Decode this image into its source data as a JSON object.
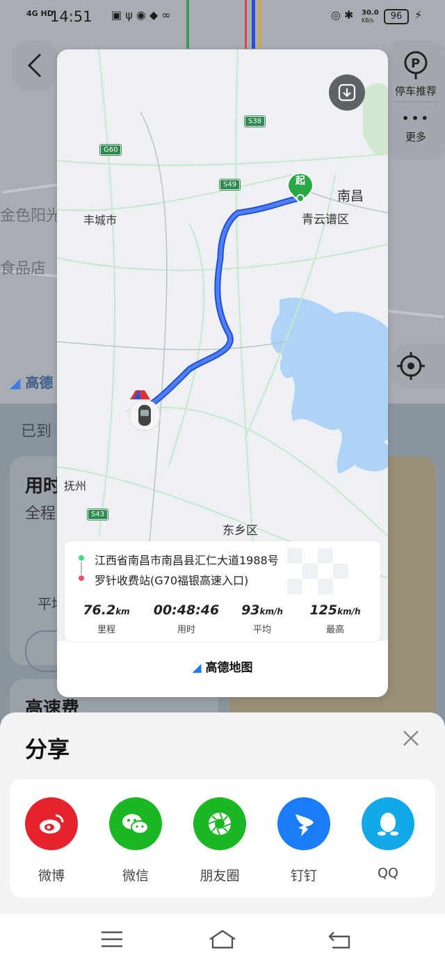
{
  "status_bar": {
    "network": "4G HD",
    "time": "14:51",
    "speed_value": "30.0",
    "speed_unit": "KB/s",
    "battery": "96"
  },
  "background": {
    "parking_label": "停车推荐",
    "more_label": "更多",
    "poi_1": "金色阳光",
    "poi_2": "食品店",
    "logo_text": "高德",
    "arrived_text": "已到",
    "time_used_text": "用时",
    "full_route_text": "全程",
    "avg_text": "平均",
    "toll_text": "高速费"
  },
  "share_card": {
    "map": {
      "start_marker": "起",
      "labels": [
        "南昌",
        "青云谱区",
        "丰城市",
        "抚州",
        "东乡区"
      ],
      "road_shields": [
        "S38",
        "G60",
        "S49",
        "S43"
      ]
    },
    "start_address": "江西省南昌市南昌县汇仁大道1988号",
    "end_address": "罗针收费站(G70福银高速入口)",
    "stats": [
      {
        "value": "76.2",
        "unit": "km",
        "label": "里程"
      },
      {
        "value": "00:48:46",
        "unit": "",
        "label": "用时"
      },
      {
        "value": "93",
        "unit": "km/h",
        "label": "平均"
      },
      {
        "value": "125",
        "unit": "km/h",
        "label": "最高"
      }
    ],
    "brand": "高德地图"
  },
  "share_sheet": {
    "title": "分享",
    "apps": [
      {
        "label": "微博",
        "color": "#e6232d",
        "icon": "weibo-icon"
      },
      {
        "label": "微信",
        "color": "#1bb823",
        "icon": "wechat-icon"
      },
      {
        "label": "朋友圈",
        "color": "#1bb823",
        "icon": "moments-icon"
      },
      {
        "label": "钉钉",
        "color": "#1a7cf7",
        "icon": "dingtalk-icon"
      },
      {
        "label": "QQ",
        "color": "#12a9e8",
        "icon": "qq-icon"
      }
    ]
  },
  "colors": {
    "route": "#3c6ff0",
    "start": "#28a745",
    "end": "#f0506e",
    "water": "#aed3f7"
  }
}
